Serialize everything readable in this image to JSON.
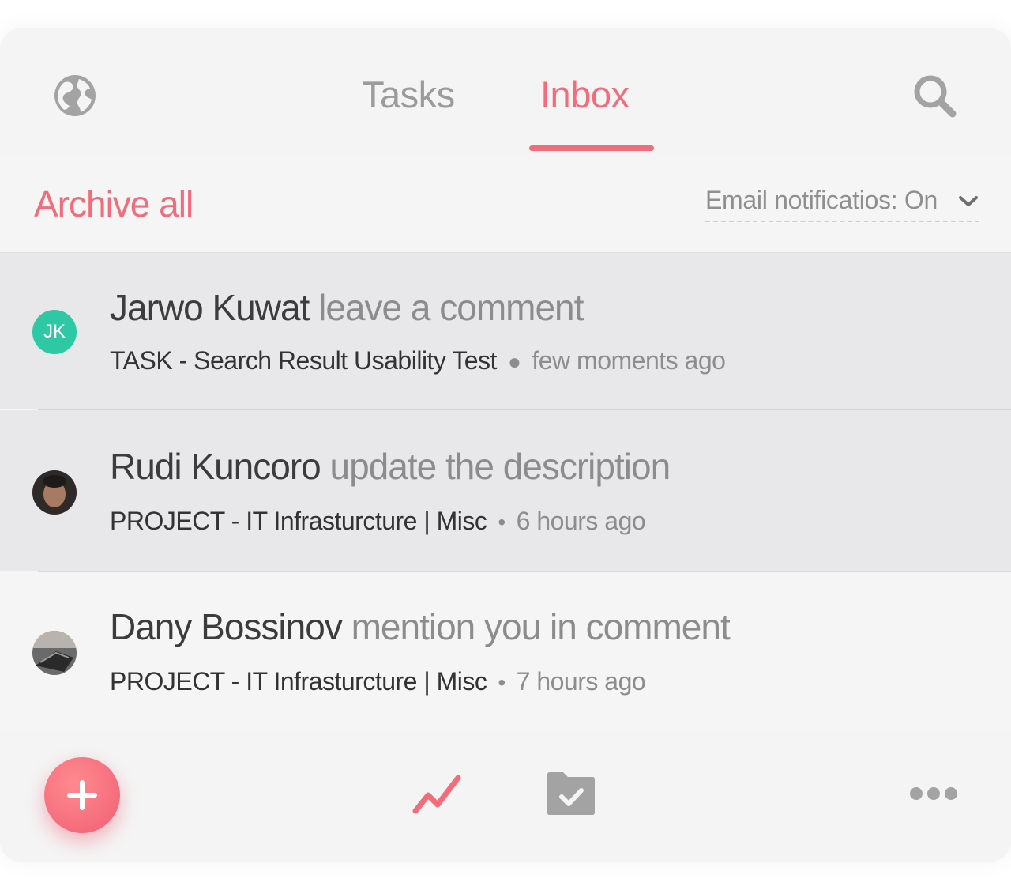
{
  "colors": {
    "accent": "#f26c7b",
    "muted": "#9b9b9b",
    "avatar_jk": "#2fc8a4"
  },
  "header": {
    "globe_icon": "globe-icon",
    "tabs": [
      {
        "label": "Tasks",
        "active": false
      },
      {
        "label": "Inbox",
        "active": true
      }
    ],
    "search_icon": "search-icon"
  },
  "toolbar": {
    "archive_label": "Archive all",
    "email_notifications_label": "Email notificatios: On"
  },
  "notifications": [
    {
      "avatar_initials": "JK",
      "user": "Jarwo Kuwat",
      "action": "leave a comment",
      "context": "TASK - Search Result Usability Test",
      "time": "few moments ago",
      "unread": true
    },
    {
      "user": "Rudi Kuncoro",
      "action": "update the description",
      "context": "PROJECT - IT Infrasturcture | Misc",
      "time": "6 hours ago",
      "unread": true
    },
    {
      "user": "Dany Bossinov",
      "action": "mention you in comment",
      "context": "PROJECT - IT Infrasturcture | Misc",
      "time": "7 hours ago",
      "unread": false
    }
  ],
  "bottom_bar": {
    "add_icon": "plus-icon",
    "activity_icon": "activity-icon",
    "folder_icon": "folder-check-icon",
    "more_icon": "more-icon"
  }
}
